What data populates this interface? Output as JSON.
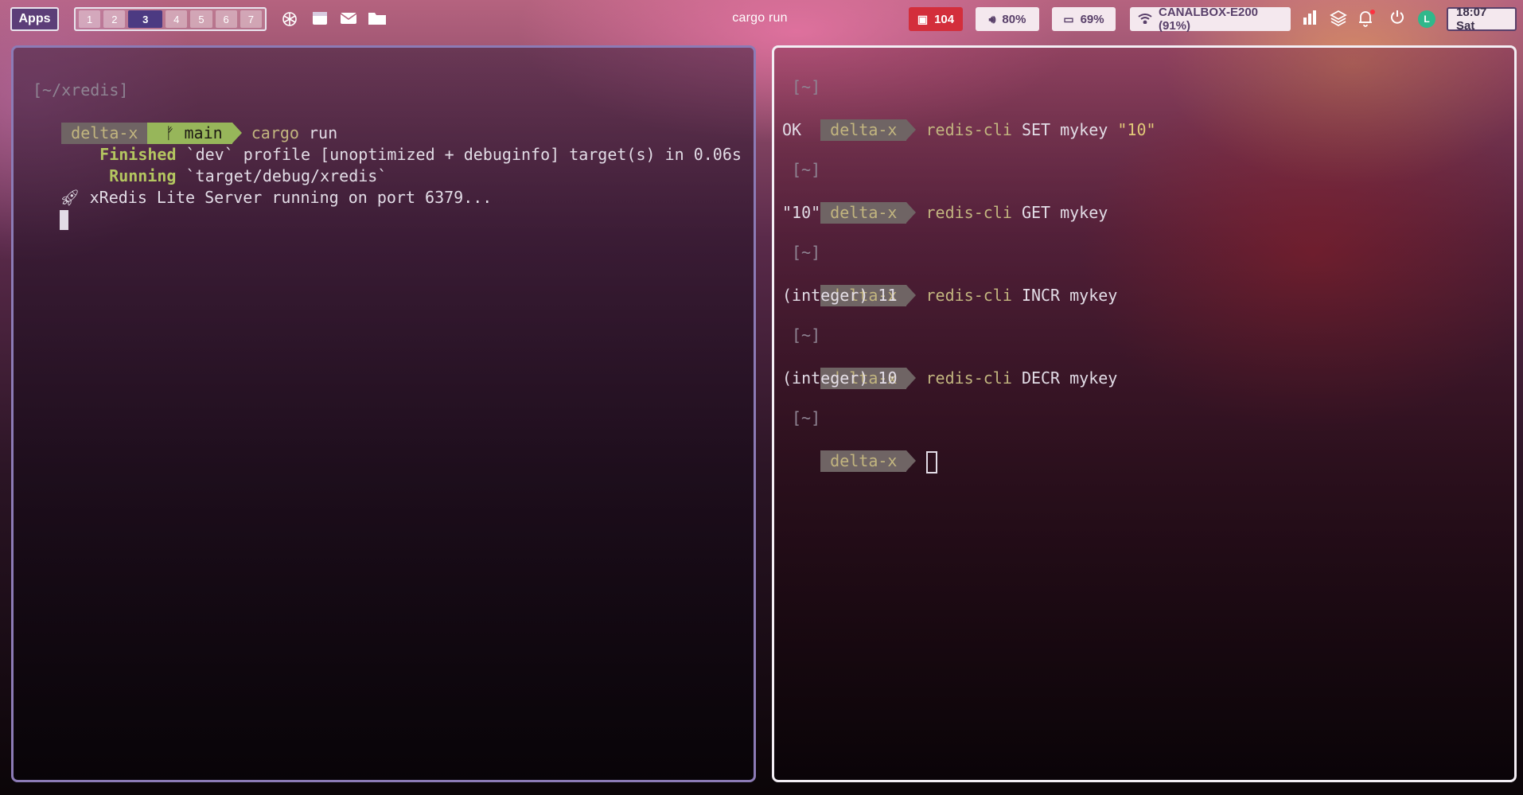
{
  "topbar": {
    "apps_label": "Apps",
    "workspaces": [
      "1",
      "2",
      "3",
      "4",
      "5",
      "6",
      "7"
    ],
    "active_workspace": "3",
    "launcher_icons": [
      "openai-icon",
      "calendar-icon",
      "mail-icon",
      "folder-icon"
    ],
    "window_title": "cargo run",
    "packages": {
      "icon": "package-icon",
      "value": "104",
      "color": "#d32e3b"
    },
    "volume": {
      "icon": "speaker-icon",
      "value": "80%"
    },
    "battery": {
      "icon": "battery-icon",
      "value": "69%"
    },
    "wifi": {
      "icon": "wifi-icon",
      "value": "CANALBOX-E200 (91%)"
    },
    "tray_icons": [
      "chart-icon",
      "layers-icon",
      "bell-icon",
      "power-icon",
      "avatar-icon"
    ],
    "clock": "18:07 Sat"
  },
  "left_terminal": {
    "cwd": "[~/xredis]",
    "host": "delta-x",
    "branch_icon": "git-branch-icon",
    "branch": "main",
    "command_name": "cargo",
    "command_args": "run",
    "finished_label": "Finished",
    "finished_text": "`dev` profile [unoptimized + debuginfo] target(s) in 0.06s",
    "running_label": "Running",
    "running_text": "`target/debug/xredis`",
    "server_icon": "rocket-icon",
    "server_text": "xRedis Lite Server running on port 6379..."
  },
  "right_terminal": {
    "entries": [
      {
        "cwd": "[~]",
        "host": "delta-x",
        "cmd": "redis-cli",
        "args": "SET mykey",
        "str": "\"10\"",
        "output": "OK"
      },
      {
        "cwd": "[~]",
        "host": "delta-x",
        "cmd": "redis-cli",
        "args": "GET mykey",
        "str": "",
        "output": "\"10\""
      },
      {
        "cwd": "[~]",
        "host": "delta-x",
        "cmd": "redis-cli",
        "args": "INCR mykey",
        "str": "",
        "output": "(integer) 11"
      },
      {
        "cwd": "[~]",
        "host": "delta-x",
        "cmd": "redis-cli",
        "args": "DECR mykey",
        "str": "",
        "output": "(integer) 10"
      }
    ],
    "final_cwd": "[~]",
    "final_host": "delta-x"
  }
}
